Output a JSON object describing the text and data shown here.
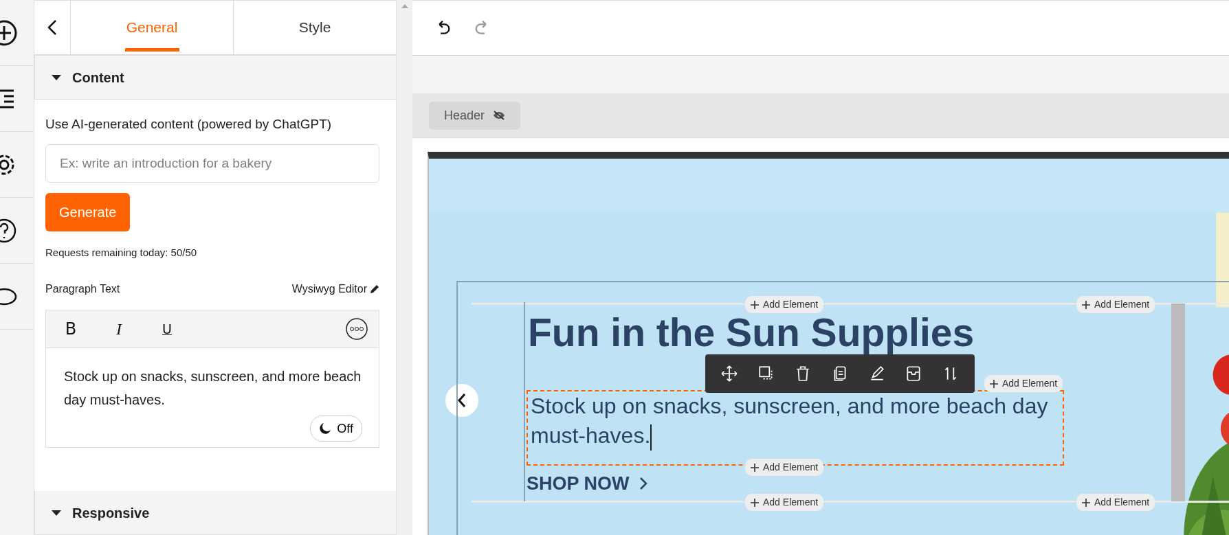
{
  "panel": {
    "tabs": [
      {
        "label": "General",
        "selected": true
      },
      {
        "label": "Style",
        "selected": false
      }
    ],
    "sections": [
      {
        "title": "Content",
        "expanded": true
      },
      {
        "title": "Responsive",
        "expanded": true
      }
    ],
    "ai": {
      "label": "Use AI-generated content (powered by ChatGPT)",
      "placeholder": "Ex: write an introduction for a bakery",
      "button": "Generate",
      "remaining": "Requests remaining today: 50/50"
    },
    "paragraph": {
      "label": "Paragraph Text",
      "editor_link": "Wysiwyg Editor",
      "format_buttons": [
        "B",
        "I",
        "U"
      ],
      "text": "Stock up on snacks, sunscreen, and more beach day must-haves.",
      "dark_toggle": {
        "label": "Off",
        "on": false
      }
    }
  },
  "history": {
    "undo": {
      "disabled": false
    },
    "redo": {
      "disabled": true
    }
  },
  "canvas": {
    "header_tag": "Header",
    "hero": {
      "heading": "Fun in the Sun Supplies",
      "paragraph": "Stock up on snacks, sunscreen, and more beach day must-haves.",
      "link": "SHOP NOW",
      "add_element": [
        "Add Element",
        "Add Element",
        "Add Element",
        "Add Element",
        "Add Element",
        "Add Element"
      ]
    }
  }
}
